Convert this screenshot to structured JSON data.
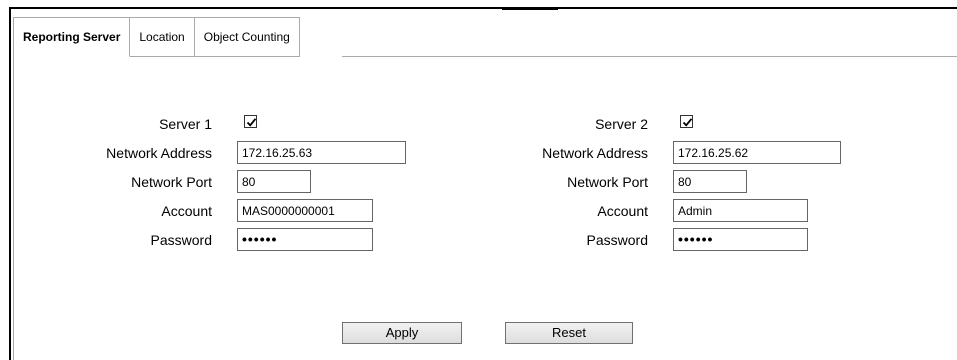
{
  "tabs": [
    {
      "label": "Reporting Server",
      "active": true
    },
    {
      "label": "Location",
      "active": false
    },
    {
      "label": "Object Counting",
      "active": false
    }
  ],
  "server1": {
    "server_label": "Server 1",
    "enabled": true,
    "address_label": "Network Address",
    "address_value": "172.16.25.63",
    "port_label": "Network Port",
    "port_value": "80",
    "account_label": "Account",
    "account_value": "MAS0000000001",
    "password_label": "Password",
    "password_mask": "••••••"
  },
  "server2": {
    "server_label": "Server 2",
    "enabled": true,
    "address_label": "Network Address",
    "address_value": "172.16.25.62",
    "port_label": "Network Port",
    "port_value": "80",
    "account_label": "Account",
    "account_value": "Admin",
    "password_label": "Password",
    "password_mask": "••••••"
  },
  "buttons": {
    "apply": "Apply",
    "reset": "Reset"
  }
}
